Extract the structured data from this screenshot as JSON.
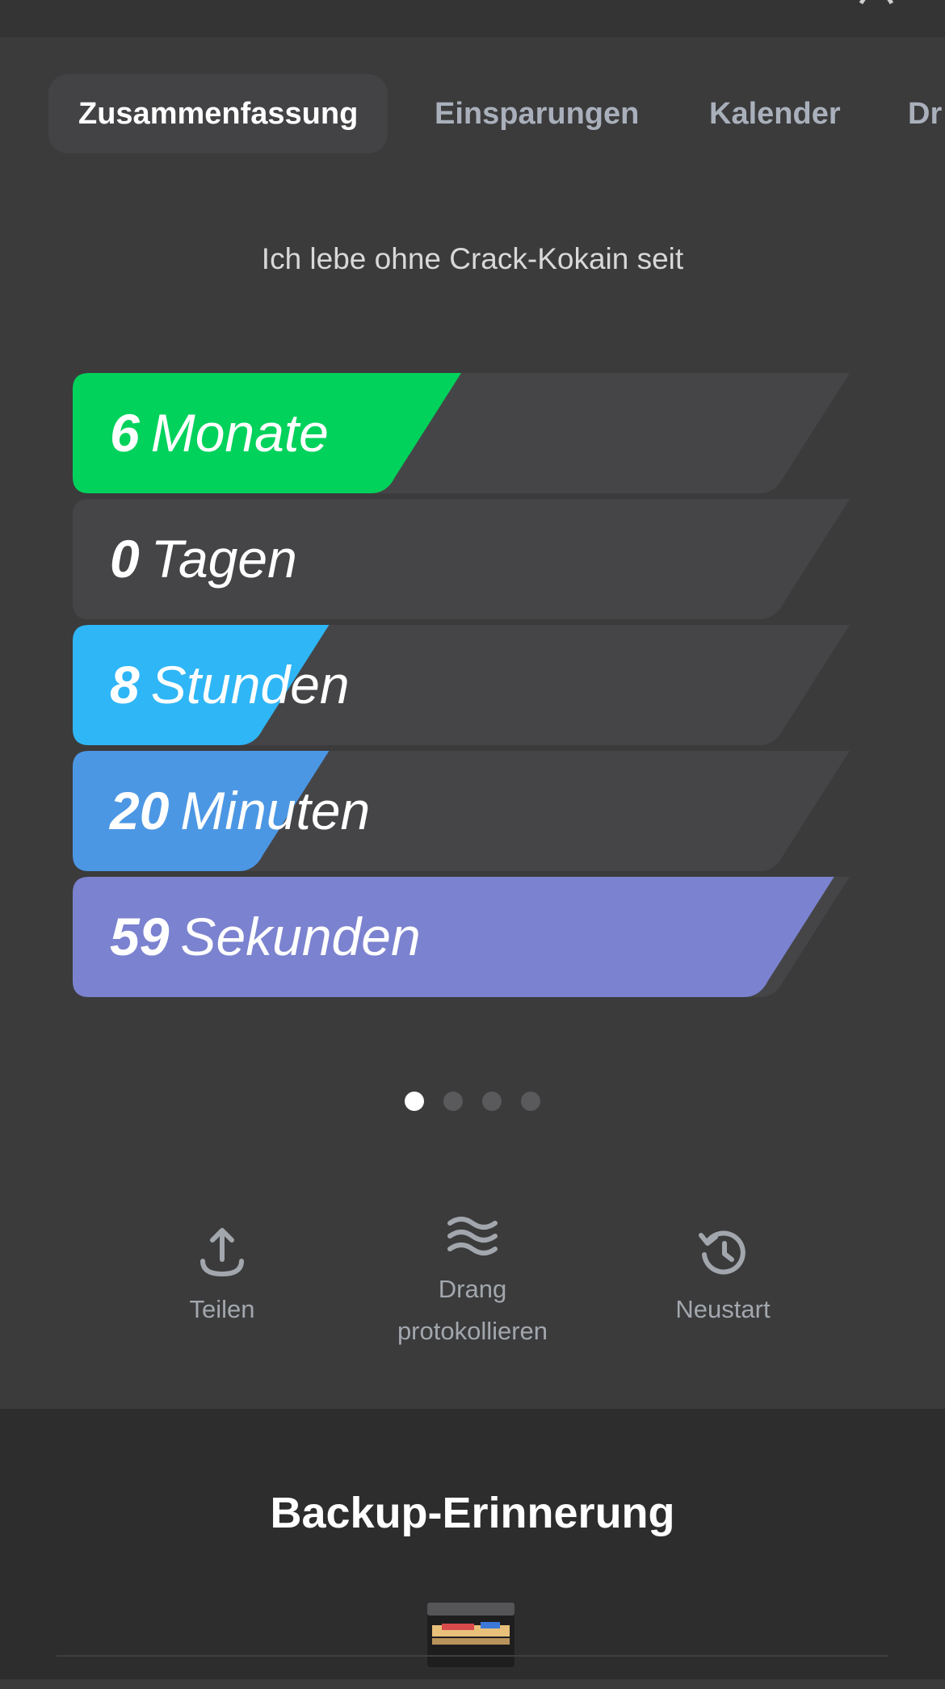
{
  "tabs": [
    {
      "label": "Zusammenfassung",
      "active": true
    },
    {
      "label": "Einsparungen",
      "active": false
    },
    {
      "label": "Kalender",
      "active": false
    },
    {
      "label": "Dr",
      "active": false
    }
  ],
  "subtitle": "Ich lebe ohne Crack-Kokain seit",
  "counters": [
    {
      "value": "6",
      "unit": "Monate",
      "progress": 0.5,
      "color": "#00d25b"
    },
    {
      "value": "0",
      "unit": "Tagen",
      "progress": 0.0,
      "color": "#4a4a4c"
    },
    {
      "value": "8",
      "unit": "Stunden",
      "progress": 0.33,
      "color": "#2fb6f6"
    },
    {
      "value": "20",
      "unit": "Minuten",
      "progress": 0.33,
      "color": "#4c97e4"
    },
    {
      "value": "59",
      "unit": "Sekunden",
      "progress": 0.98,
      "color": "#7b82cf"
    }
  ],
  "pager": {
    "pages": 4,
    "current": 1
  },
  "actions": {
    "share_label": "Teilen",
    "urge_label_line1": "Drang",
    "urge_label_line2": "protokollieren",
    "restart_label": "Neustart"
  },
  "panel": {
    "title": "Backup-Erinnerung"
  },
  "icons": {
    "share": "share-upload-icon",
    "urge": "waves-icon",
    "restart": "restart-history-icon",
    "backup": "card-box-icon"
  }
}
